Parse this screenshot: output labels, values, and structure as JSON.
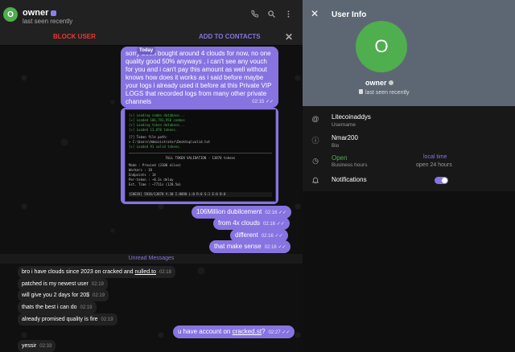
{
  "header": {
    "avatar_letter": "O",
    "name": "owner",
    "status": "last seen recently"
  },
  "actionbar": {
    "block_label": "BLOCK USER",
    "add_label": "ADD TO CONTACTS"
  },
  "messages_out_top": {
    "date_label": "Today",
    "text": "sorry been bought around 4 clouds for now, no one quality good 50% anyways , i can't see any vouch for you and i can't pay this amount as well without knows how does it works as i said before maybe your logs i already used it before at this Private VIP LOGS that recorded logs from many other private channels",
    "time": "02:15"
  },
  "terminal": {
    "lines": [
      "[+] Loading combo database...",
      "[+] Loaded 106,793,950 combos",
      "[+] Loading token database...",
      "[+] Loaded 13,870 tokens.",
      "[?] Token file path:",
      "> C:\\Users\\Administrator\\Desktop\\valid.txt",
      "[+] Loaded 91 valid tokens.",
      "FULL TOKEN VALIDATION - 13870 tokens",
      "Mode     : Proxied (3100 alive)",
      "Workers  : 18",
      "Endpoints : 14",
      "Per-token : ~0.3s delay",
      "Est. Time : ~7711s (128.5m)",
      "[CHECK] 5936/13870  V:30  I:8890  L:0  R:0  S:1  E:0  B:0"
    ]
  },
  "messages_out": [
    {
      "text": "106Million dubilcement",
      "time": "02:16"
    },
    {
      "text": "from 4x clouds",
      "time": "02:16"
    },
    {
      "text": "different",
      "time": "02:16"
    },
    {
      "text": "that make sense",
      "time": "02:16"
    }
  ],
  "unread_label": "Unread Messages",
  "messages_in": [
    {
      "text": "bro i have clouds since 2023 on cracked and ",
      "link": "nulled.to",
      "time": "02:18"
    },
    {
      "text": "patched is my newest user",
      "time": "02:19"
    },
    {
      "text": "will give you 2 days for 20$",
      "time": "02:19"
    },
    {
      "text": "thats the best i can do",
      "time": "02:19"
    },
    {
      "text": "already promised quality is fire",
      "time": "02:19"
    },
    {
      "text": "yessir",
      "time": "02:33"
    }
  ],
  "message_out_last": {
    "text": "u have account on ",
    "link": "cracked.st",
    "suffix": "?",
    "time": "02:27"
  },
  "panel": {
    "title": "User Info",
    "avatar_letter": "O",
    "name": "owner",
    "status": "last seen recently",
    "username_value": "Litecoinaddys",
    "username_label": "Username",
    "bio_value": "Nmar200",
    "bio_label": "Bio",
    "hours_value": "Open",
    "hours_label": "Business hours",
    "hours_right_top": "local time",
    "hours_right_bottom": "open 24 hours",
    "notifications_label": "Notifications",
    "notifications_on": true
  },
  "colors": {
    "accent": "#8774e1",
    "danger": "#e53935",
    "avatar": "#4fae4e",
    "open": "#4fae4e"
  },
  "icons": [
    "phone-icon",
    "search-icon",
    "more-icon",
    "close-icon",
    "at-icon",
    "info-icon",
    "clock-icon",
    "bell-icon",
    "verified-icon"
  ]
}
